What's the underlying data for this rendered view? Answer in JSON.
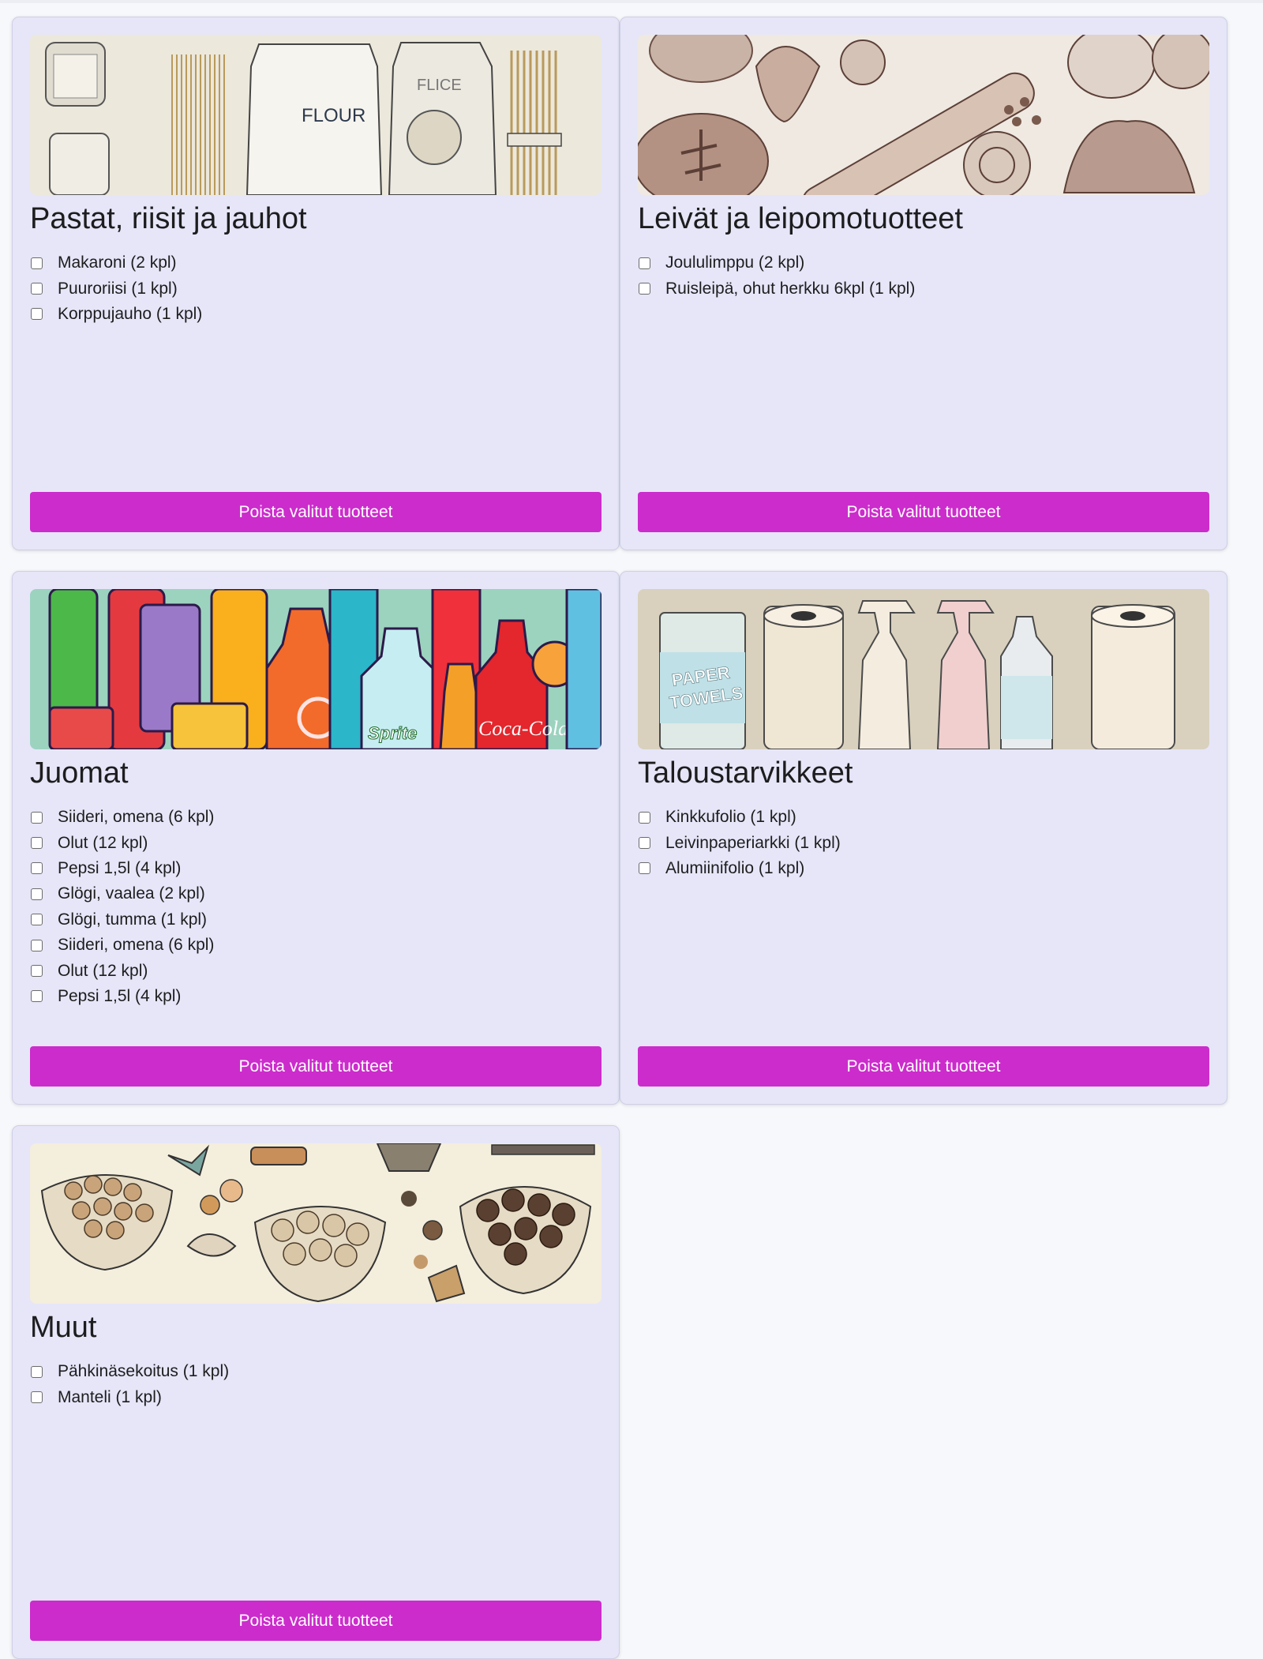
{
  "categories": [
    {
      "title": "Pastat, riisit ja jauhot",
      "banner_icon": "flour-pasta-image",
      "banner_text": [
        "FLOUR",
        "FLICE"
      ],
      "items": [
        "Makaroni (2 kpl)",
        "Puuroriisi (1 kpl)",
        "Korppujauho (1 kpl)"
      ],
      "button_label": "Poista valitut tuotteet"
    },
    {
      "title": "Leivät ja leipomotuotteet",
      "banner_icon": "bakery-image",
      "items": [
        "Joululimppu (2 kpl)",
        "Ruisleipä, ohut herkku 6kpl (1 kpl)"
      ],
      "button_label": "Poista valitut tuotteet"
    },
    {
      "title": "Juomat",
      "banner_icon": "drinks-image",
      "banner_text": [
        "Sprite",
        "Coca-Cola"
      ],
      "items": [
        "Siideri, omena (6 kpl)",
        "Olut (12 kpl)",
        "Pepsi 1,5l (4 kpl)",
        "Glögi, vaalea (2 kpl)",
        "Glögi, tumma (1 kpl)",
        "Siideri, omena (6 kpl)",
        "Olut (12 kpl)",
        "Pepsi 1,5l (4 kpl)"
      ],
      "button_label": "Poista valitut tuotteet"
    },
    {
      "title": "Taloustarvikkeet",
      "banner_icon": "household-supplies-image",
      "banner_text": [
        "PAPER",
        "TOWELS"
      ],
      "items": [
        "Kinkkufolio (1 kpl)",
        "Leivinpaperiarkki (1 kpl)",
        "Alumiinifolio (1 kpl)"
      ],
      "button_label": "Poista valitut tuotteet"
    },
    {
      "title": "Muut",
      "banner_icon": "nuts-sweets-image",
      "items": [
        "Pähkinäsekoitus (1 kpl)",
        "Manteli (1 kpl)"
      ],
      "button_label": "Poista valitut tuotteet"
    }
  ],
  "colors": {
    "card_background": "#e6e6f8",
    "button_background": "#cc2ccc",
    "button_text": "#ffffff",
    "page_background": "#f7f8fb"
  }
}
